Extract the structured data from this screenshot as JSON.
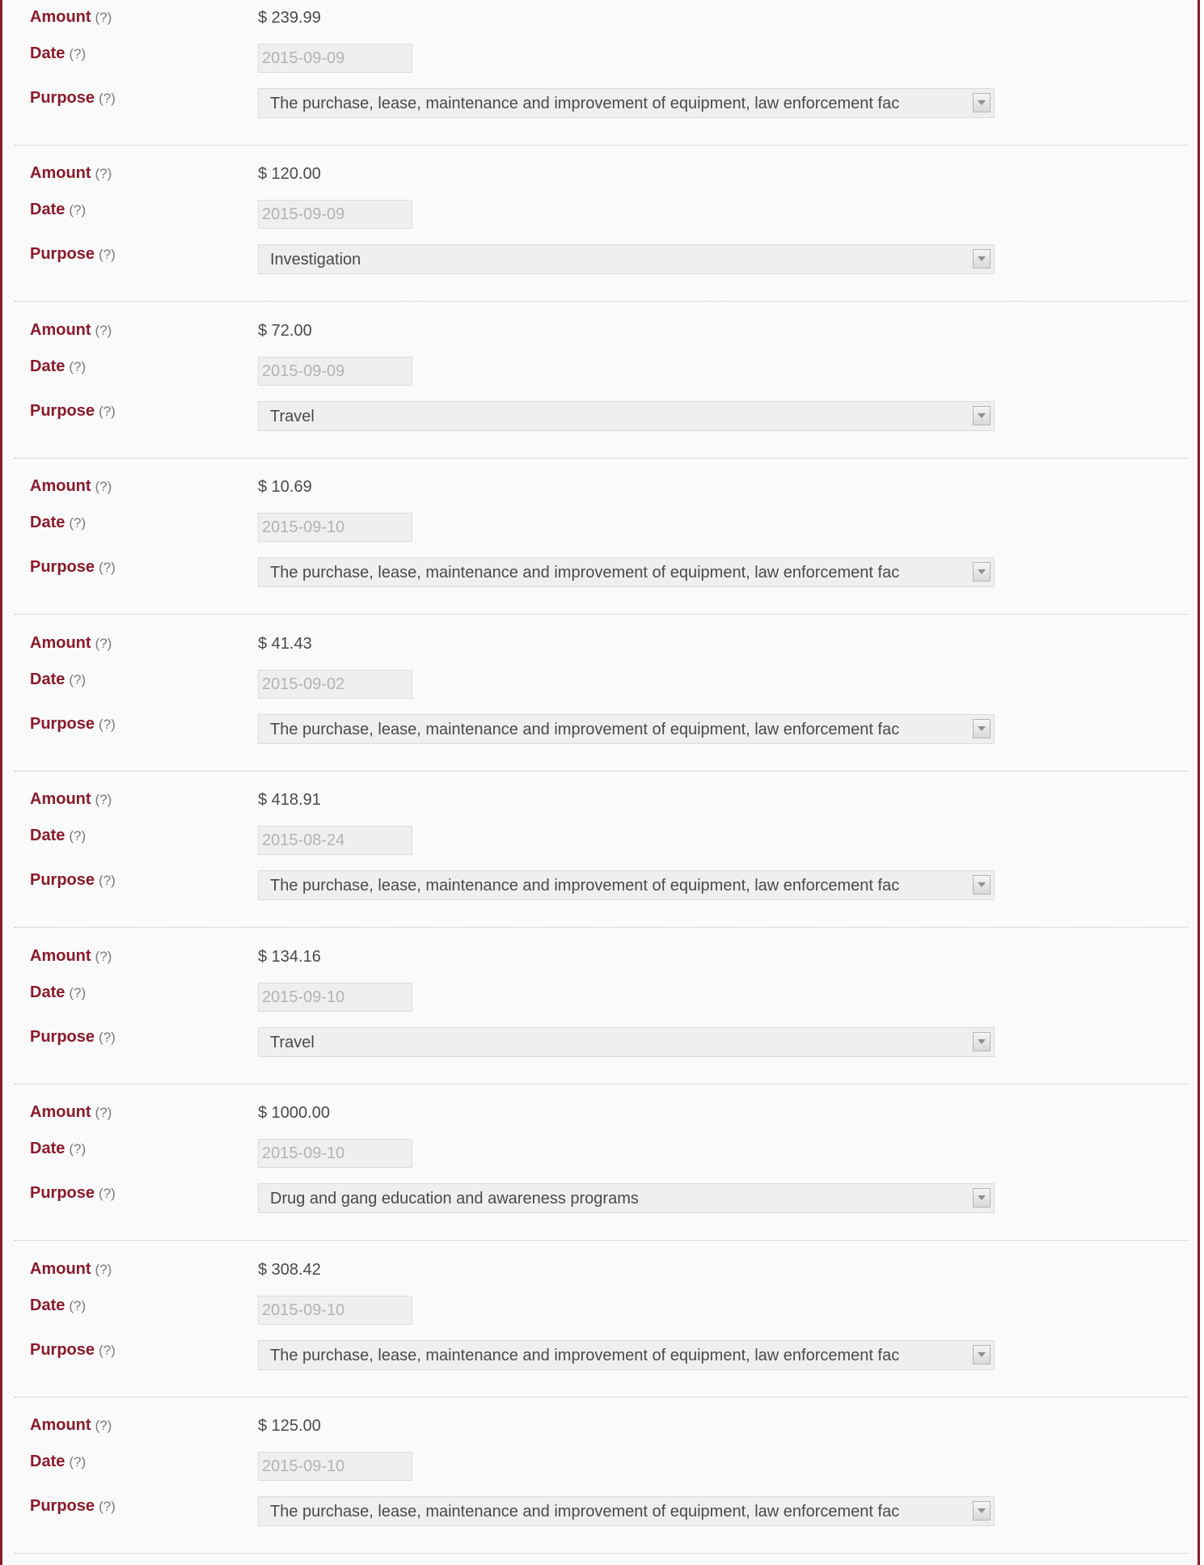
{
  "help_text": "(?)",
  "labels": {
    "amount": "Amount",
    "date": "Date",
    "purpose": "Purpose"
  },
  "entries": [
    {
      "amount": "$ 239.99",
      "date": "2015-09-09",
      "purpose": "The purchase, lease, maintenance and improvement of equipment, law enforcement fac"
    },
    {
      "amount": "$ 120.00",
      "date": "2015-09-09",
      "purpose": "Investigation"
    },
    {
      "amount": "$ 72.00",
      "date": "2015-09-09",
      "purpose": "Travel"
    },
    {
      "amount": "$ 10.69",
      "date": "2015-09-10",
      "purpose": "The purchase, lease, maintenance and improvement of equipment, law enforcement fac"
    },
    {
      "amount": "$ 41.43",
      "date": "2015-09-02",
      "purpose": "The purchase, lease, maintenance and improvement of equipment, law enforcement fac"
    },
    {
      "amount": "$ 418.91",
      "date": "2015-08-24",
      "purpose": "The purchase, lease, maintenance and improvement of equipment, law enforcement fac"
    },
    {
      "amount": "$ 134.16",
      "date": "2015-09-10",
      "purpose": "Travel"
    },
    {
      "amount": "$ 1000.00",
      "date": "2015-09-10",
      "purpose": "Drug and gang education and awareness programs"
    },
    {
      "amount": "$ 308.42",
      "date": "2015-09-10",
      "purpose": "The purchase, lease, maintenance and improvement of equipment, law enforcement fac"
    },
    {
      "amount": "$ 125.00",
      "date": "2015-09-10",
      "purpose": "The purchase, lease, maintenance and improvement of equipment, law enforcement fac"
    }
  ],
  "colors": {
    "accent": "#8b1a2b",
    "text": "#4a4a4a",
    "muted": "#b3b3b3",
    "field_bg": "#efefef"
  }
}
